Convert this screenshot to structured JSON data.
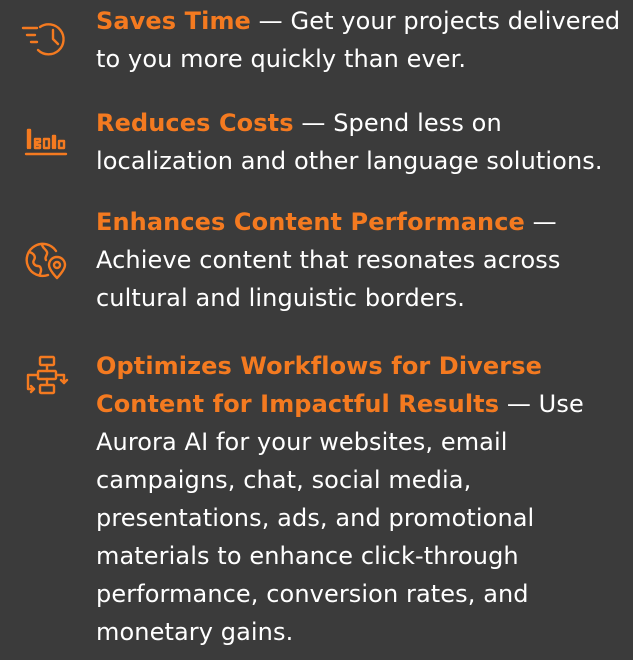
{
  "colors": {
    "background": "#3b3b3b",
    "accent": "#f47a20",
    "text": "#ffffff"
  },
  "items": [
    {
      "icon": "time-fast-icon",
      "title": "Saves Time",
      "separator": " — ",
      "body": "Get your projects delivered to you more quickly than ever."
    },
    {
      "icon": "cost-chart-icon",
      "title": "Reduces Costs",
      "separator": " — ",
      "body": "Spend less on localization and other language solutions."
    },
    {
      "icon": "globe-location-icon",
      "title": "Enhances Content Performance",
      "separator": " — ",
      "body": "Achieve content that resonates across cultural and linguistic borders."
    },
    {
      "icon": "workflow-icon",
      "title": "Optimizes Workflows for Diverse Content for Impactful Results",
      "separator": " — ",
      "body": "Use Aurora AI for your websites, email campaigns, chat, social media, presentations, ads, and promotional materials to enhance click-through performance, conversion rates, and monetary gains."
    }
  ]
}
